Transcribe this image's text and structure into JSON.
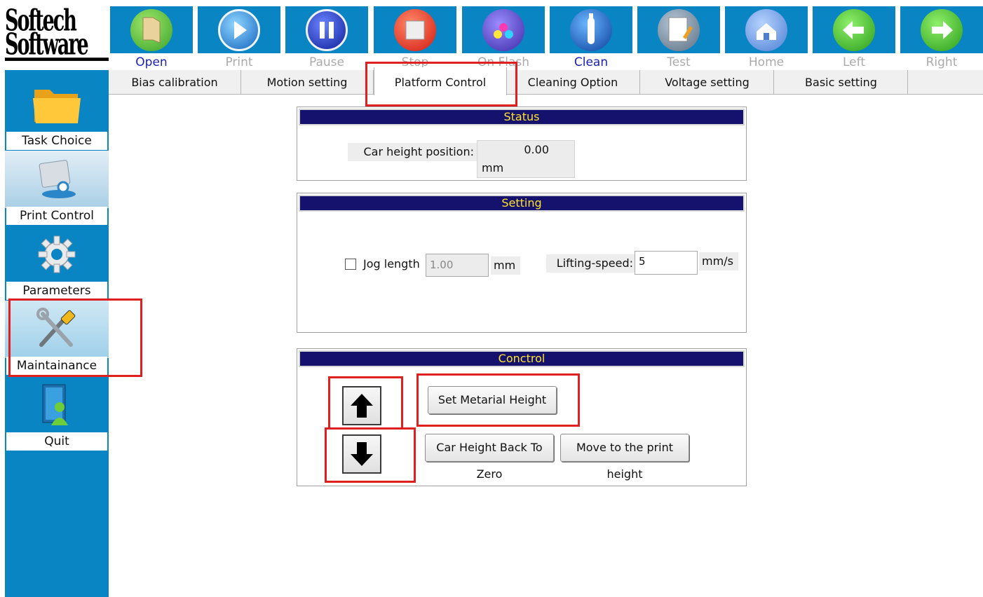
{
  "logo": {
    "text": "Softech Software"
  },
  "sidebar": {
    "items": [
      {
        "label": "Task Choice",
        "icon": "folder-icon"
      },
      {
        "label": "Print Control",
        "icon": "print-control-icon"
      },
      {
        "label": "Parameters",
        "icon": "gear-icon"
      },
      {
        "label": "Maintainance",
        "icon": "tools-icon"
      },
      {
        "label": "Quit",
        "icon": "user-exit-icon"
      }
    ]
  },
  "toolbar": {
    "buttons": [
      {
        "label": "Open",
        "icon": "open-icon",
        "enabled": true
      },
      {
        "label": "Print",
        "icon": "play-icon",
        "enabled": false
      },
      {
        "label": "Pause",
        "icon": "pause-icon",
        "enabled": false
      },
      {
        "label": "Stop",
        "icon": "stop-icon",
        "enabled": false
      },
      {
        "label": "On Flash",
        "icon": "flash-icon",
        "enabled": false
      },
      {
        "label": "Clean",
        "icon": "clean-icon",
        "enabled": true
      },
      {
        "label": "Test",
        "icon": "test-icon",
        "enabled": false
      },
      {
        "label": "Home",
        "icon": "home-icon",
        "enabled": false
      },
      {
        "label": "Left",
        "icon": "arrow-left-icon",
        "enabled": false
      },
      {
        "label": "Right",
        "icon": "arrow-right-icon",
        "enabled": false
      }
    ]
  },
  "tabs": [
    {
      "label": "Bias calibration"
    },
    {
      "label": "Motion setting"
    },
    {
      "label": "Platform Control",
      "active": true
    },
    {
      "label": "Cleaning Option"
    },
    {
      "label": "Voltage setting"
    },
    {
      "label": "Basic setting"
    }
  ],
  "status": {
    "header": "Status",
    "car_height_label": "Car height position:",
    "car_height_value": "0.00",
    "car_height_unit": "mm"
  },
  "setting": {
    "header": "Setting",
    "jog_label": "Jog length",
    "jog_checked": false,
    "jog_value": "1.00",
    "jog_unit": "mm",
    "lift_label": "Lifting-speed:",
    "lift_value": "5",
    "lift_unit": "mm/s"
  },
  "control": {
    "header": "Conctrol",
    "set_material_height": "Set Metarial Height",
    "car_back_zero": "Car Height Back To Zero",
    "move_print_height": "Move to  the print height"
  },
  "colors": {
    "sidebar_blue": "#0a85c4",
    "header_navy": "#15126e",
    "header_text": "#ffe22a",
    "highlight_red": "#e02020",
    "enabled_label": "#1a20b8",
    "disabled_label": "#aaaaaa"
  }
}
